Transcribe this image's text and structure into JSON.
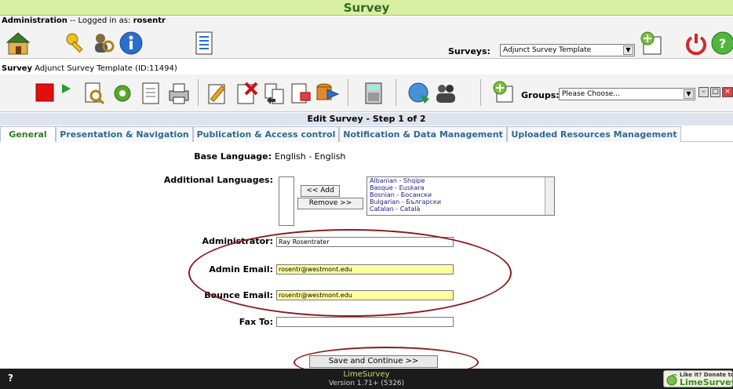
{
  "window": {
    "title": "Survey"
  },
  "admin": {
    "prefix": "Administration",
    "logged_text": " -- Logged in as: ",
    "user": "rosentr"
  },
  "surveys": {
    "label": "Surveys:",
    "selected": "Adjunct Survey Template"
  },
  "survey_info": {
    "prefix": "Survey",
    "name": "Adjunct Survey Template (ID:11494)"
  },
  "groups": {
    "label": "Groups:",
    "selected": "Please Choose..."
  },
  "page": {
    "step_title": "Edit Survey - Step 1 of 2"
  },
  "tabs": [
    {
      "label": "General"
    },
    {
      "label": "Presentation & Navigation"
    },
    {
      "label": "Publication & Access control"
    },
    {
      "label": "Notification & Data Management"
    },
    {
      "label": "Uploaded Resources Management"
    }
  ],
  "form": {
    "base_language_label": "Base Language:",
    "base_language_value": "English - English",
    "additional_languages_label": "Additional Languages:",
    "add_button": "<< Add",
    "remove_button": "Remove >>",
    "language_options": [
      "Albanian - Shqipe",
      "Basque - Euskara",
      "Bosnian - Босански",
      "Bulgarian - Български",
      "Catalan - Català"
    ],
    "administrator_label": "Administrator:",
    "administrator_value": "Ray Rosentrater",
    "admin_email_label": "Admin Email:",
    "admin_email_value": "rosentr@westmont.edu",
    "bounce_email_label": "Bounce Email:",
    "bounce_email_value": "rosentr@westmont.edu",
    "fax_label": "Fax To:",
    "fax_value": "",
    "save_button": "Save and Continue >>"
  },
  "footer": {
    "help": "?",
    "app_name": "LimeSurvey",
    "version": "Version 1.71+ (5326)",
    "donate_line1": "Like it? Donate to",
    "donate_line2": "LimeSurvey"
  },
  "colors": {
    "title_bar": "#d9f0a3",
    "title_text": "#2f6b1e",
    "highlight_field": "#ffffa0",
    "annotation_oval": "#8b1a1a",
    "footer_bg": "#1b1b1b"
  }
}
